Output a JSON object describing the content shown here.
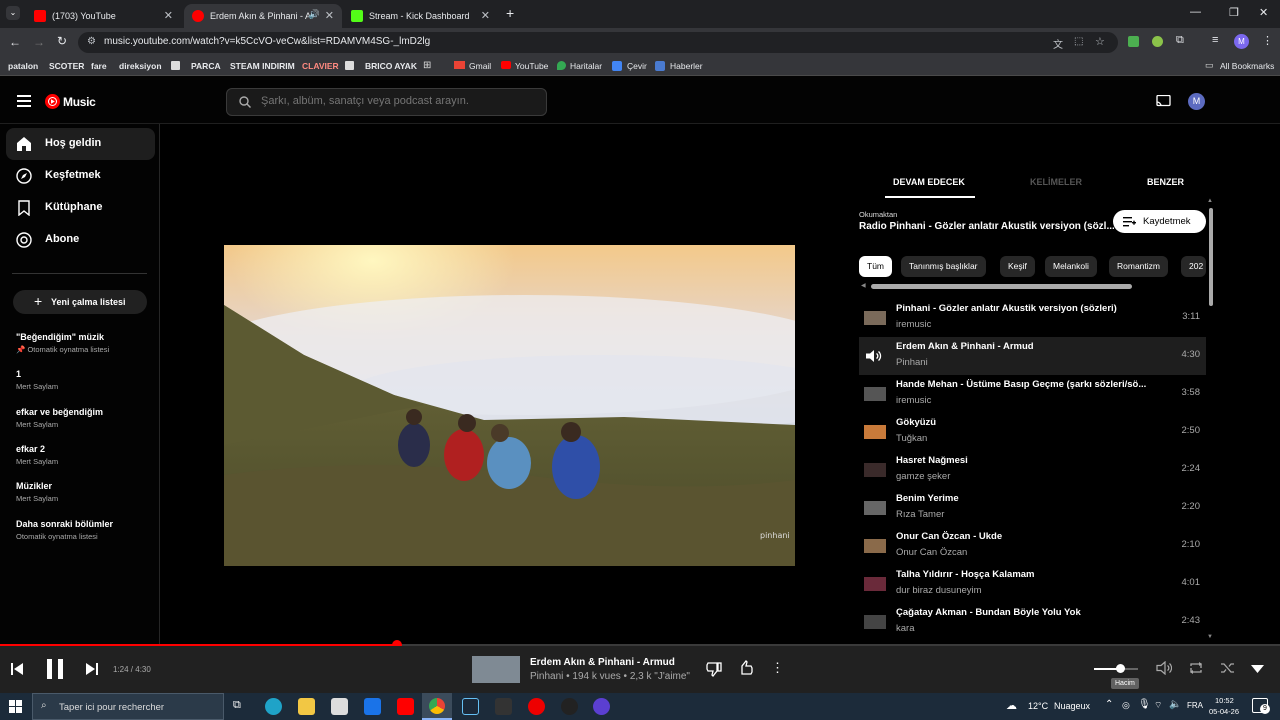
{
  "browser": {
    "tabs": [
      {
        "title": "(1703) YouTube",
        "active": false
      },
      {
        "title": "Erdem Akın & Pinhani - Ar",
        "active": true
      },
      {
        "title": "Stream - Kick Dashboard",
        "active": false
      }
    ],
    "url": "music.youtube.com/watch?v=k5CcVO-veCw&list=RDAMVM4SG-_lmD2lg",
    "profile_initial": "M",
    "bookmarks": [
      "patalon",
      "SCOTER",
      "fare",
      "direksiyon",
      "PARCA",
      "STEAM INDIRIM",
      "CLAVIER",
      "BRICO AYAK",
      "Gmail",
      "YouTube",
      "Haritalar",
      "Çevir",
      "Haberler"
    ],
    "all_bookmarks": "All Bookmarks"
  },
  "ytm": {
    "logo": "Music",
    "search_placeholder": "Şarkı, albüm, sanatçı veya podcast arayın.",
    "avatar_initial": "M",
    "nav": [
      {
        "label": "Hoş geldin",
        "icon": "home-icon",
        "active": true
      },
      {
        "label": "Keşfetmek",
        "icon": "explore-icon",
        "active": false
      },
      {
        "label": "Kütüphane",
        "icon": "library-icon",
        "active": false
      },
      {
        "label": "Abone",
        "icon": "subscriptions-icon",
        "active": false
      }
    ],
    "new_playlist": "Yeni çalma listesi",
    "playlists": [
      {
        "title": "\"Beğendiğim\" müzik",
        "sub": "Otomatik oynatma listesi",
        "pinned": true
      },
      {
        "title": "1",
        "sub": "Mert Saylam"
      },
      {
        "title": "efkar ve beğendiğim",
        "sub": "Mert Saylam"
      },
      {
        "title": "efkar 2",
        "sub": "Mert Saylam"
      },
      {
        "title": "Müzikler",
        "sub": "Mert Saylam"
      },
      {
        "title": "Daha sonraki bölümler",
        "sub": "Otomatik oynatma listesi"
      }
    ],
    "video_watermark": "pinhani",
    "panel_tabs": [
      "DEVAM EDECEK",
      "KELİMELER",
      "BENZER"
    ],
    "playing_from_label": "Okumaktan",
    "playing_from": "Radio Pinhani - Gözler anlatır Akustik versiyon (sözl...",
    "save_label": "Kaydetmek",
    "chips": [
      "Tüm",
      "Tanınmış başlıklar",
      "Keşif",
      "Melankoli",
      "Romantizm",
      "202"
    ],
    "queue": [
      {
        "title": "Pinhani - Gözler anlatır Akustik versiyon (sözleri)",
        "artist": "iremusic",
        "duration": "3:11",
        "thumb": "#7a6a5a"
      },
      {
        "title": "Erdem Akın & Pinhani - Armud",
        "artist": "Pinhani",
        "duration": "4:30",
        "playing": true
      },
      {
        "title": "Hande Mehan - Üstüme Basıp Geçme (şarkı sözleri/sö...",
        "artist": "iremusic",
        "duration": "3:58",
        "thumb": "#555"
      },
      {
        "title": "Gökyüzü",
        "artist": "Tuğkan",
        "duration": "2:50",
        "thumb": "#c87a3a"
      },
      {
        "title": "Hasret Nağmesi",
        "artist": "gamze şeker",
        "duration": "2:24",
        "thumb": "#3a2a2a"
      },
      {
        "title": "Benim Yerime",
        "artist": "Rıza Tamer",
        "duration": "2:20",
        "thumb": "#666"
      },
      {
        "title": "Onur Can Özcan - Ukde",
        "artist": "Onur Can Özcan",
        "duration": "2:10",
        "thumb": "#8a6a4a"
      },
      {
        "title": "Talha Yıldırır - Hoşça Kalamam",
        "artist": "dur biraz dusuneyim",
        "duration": "4:01",
        "thumb": "#6a2a3a"
      },
      {
        "title": "Çağatay Akman - Bundan Böyle Yolu Yok",
        "artist": "kara",
        "duration": "2:43",
        "thumb": "#444"
      }
    ]
  },
  "player": {
    "time": "1:24 / 4:30",
    "progress": 0.31,
    "title": "Erdem Akın & Pinhani - Armud",
    "meta": "Pinhani • 194 k vues • 2,3 k \"J'aime\"",
    "volume": 0.6,
    "volume_tooltip": "Hacim",
    "accent": "#ff0000"
  },
  "taskbar": {
    "search_placeholder": "Taper ici pour rechercher",
    "weather_temp": "12°C",
    "weather_text": "Nuageux",
    "language": "FRA",
    "time": "10:52",
    "date": "05-04-26",
    "notification_count": "9"
  }
}
